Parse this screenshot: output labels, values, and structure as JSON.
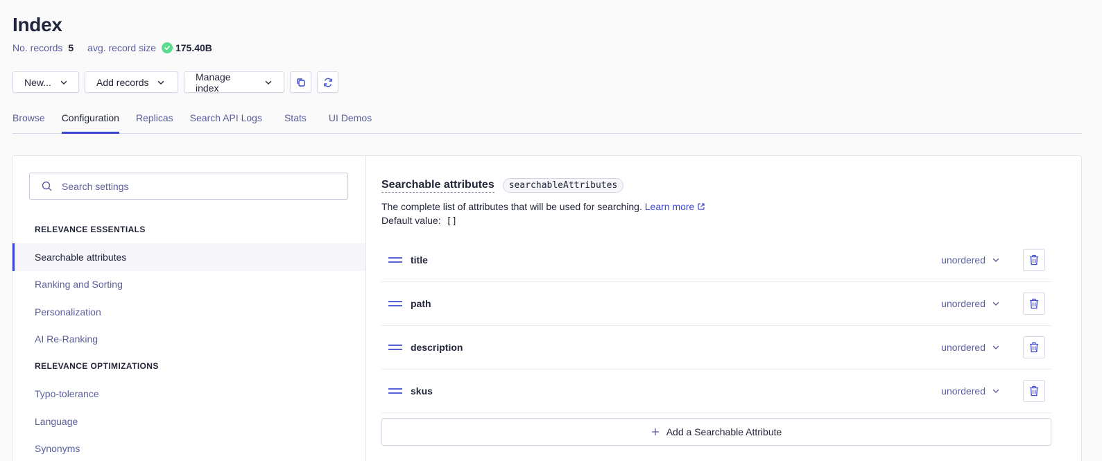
{
  "page": {
    "title": "Index",
    "records_label": "No. records",
    "records_count": "5",
    "avg_size_label": "avg. record size",
    "avg_size_value": "175.40B"
  },
  "toolbar": {
    "new_label": "New...",
    "add_records_label": "Add records",
    "manage_index_label": "Manage index"
  },
  "tabs": [
    {
      "label": "Browse"
    },
    {
      "label": "Configuration",
      "active": true
    },
    {
      "label": "Replicas"
    },
    {
      "label": "Search API Logs"
    },
    {
      "label": "Stats"
    },
    {
      "label": "UI Demos"
    }
  ],
  "sidebar": {
    "search_placeholder": "Search settings",
    "section1": "RELEVANCE ESSENTIALS",
    "items1": [
      {
        "label": "Searchable attributes",
        "active": true
      },
      {
        "label": "Ranking and Sorting"
      },
      {
        "label": "Personalization"
      },
      {
        "label": "AI Re-Ranking"
      }
    ],
    "section2": "RELEVANCE OPTIMIZATIONS",
    "items2": [
      {
        "label": "Typo-tolerance"
      },
      {
        "label": "Language"
      },
      {
        "label": "Synonyms"
      }
    ]
  },
  "content": {
    "heading": "Searchable attributes",
    "badge": "searchableAttributes",
    "description": "The complete list of attributes that will be used for searching.",
    "learn_more": "Learn more",
    "default_label": "Default value:",
    "default_value": "[]",
    "attributes": [
      {
        "name": "title",
        "order": "unordered"
      },
      {
        "name": "path",
        "order": "unordered"
      },
      {
        "name": "description",
        "order": "unordered"
      },
      {
        "name": "skus",
        "order": "unordered"
      }
    ],
    "add_label": "Add a Searchable Attribute"
  },
  "colors": {
    "accent": "#3a46d0",
    "success": "#5adc8e",
    "muted_text": "#5a5e9a"
  }
}
